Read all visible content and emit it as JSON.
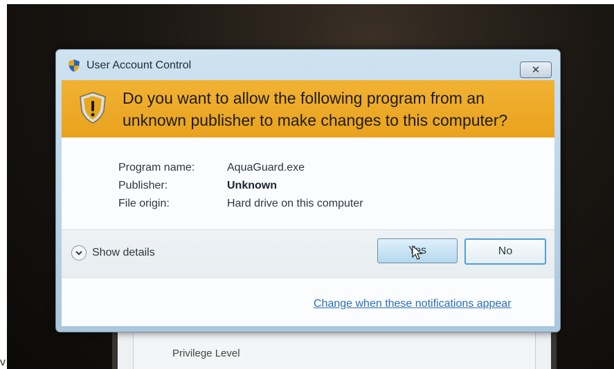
{
  "dialog": {
    "title": "User Account Control",
    "question": "Do you want to allow the following program from an unknown publisher to make changes to this computer?",
    "close_label": "✕",
    "info": [
      {
        "label": "Program name:",
        "value": "AquaGuard.exe",
        "bold": false
      },
      {
        "label": "Publisher:",
        "value": "Unknown",
        "bold": true
      },
      {
        "label": "File origin:",
        "value": "Hard drive on this computer",
        "bold": false
      }
    ],
    "show_details": "Show details",
    "yes_label": "Yes",
    "no_label": "No",
    "notify_link": "Change when these notifications appear"
  },
  "background_window": {
    "label": "Privilege Level"
  },
  "edge_glyph": "v",
  "colors": {
    "banner": "#eaa51f",
    "link": "#2a6fb5",
    "no_button_border": "#4ea0d6"
  },
  "icons": {
    "title": "uac-shield-icon",
    "banner": "warning-shield-icon",
    "details": "chevron-down-icon",
    "cursor": "mouse-pointer-icon"
  }
}
